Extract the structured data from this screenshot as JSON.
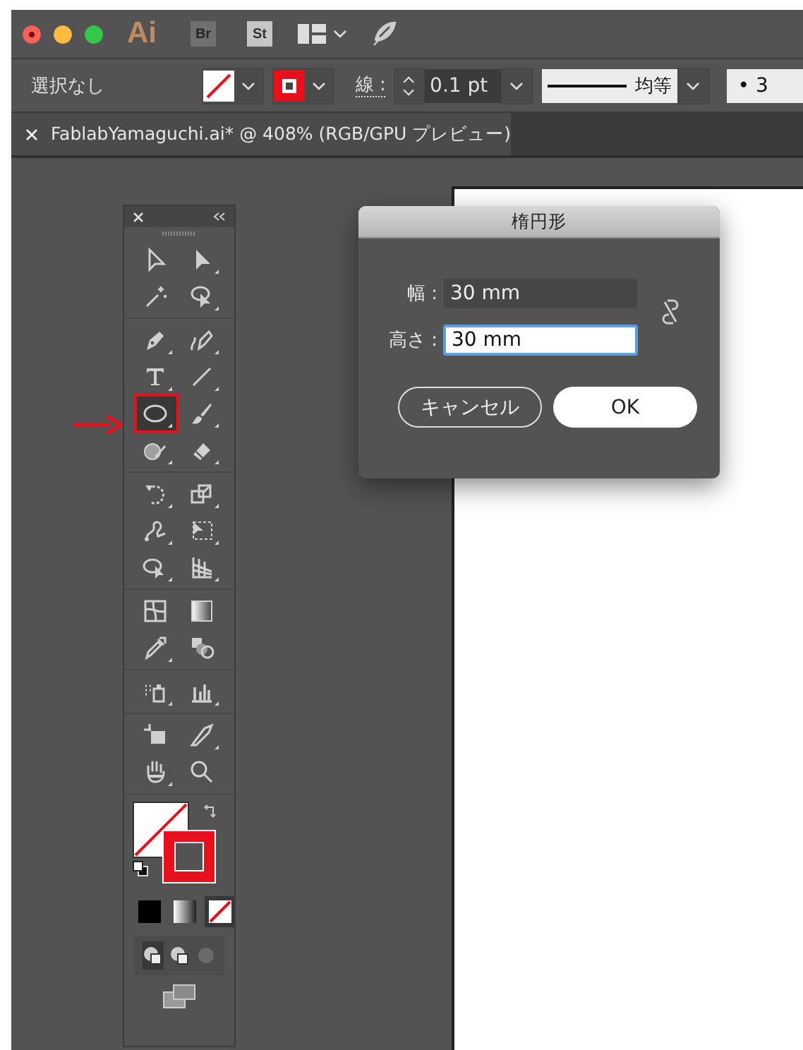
{
  "app_bar": {
    "logo": "Ai",
    "bridge": "Br",
    "stock": "St"
  },
  "control_bar": {
    "selection": "選択なし",
    "stroke_label": "線 :",
    "stroke_weight": "0.1 pt",
    "profile": "均等",
    "opacity_cut": "• 3"
  },
  "document_tab": {
    "title": "FablabYamaguchi.ai* @ 408% (RGB/GPU プレビュー)",
    "selected": true
  },
  "tool_groups": [
    {
      "tools": [
        {
          "selected": false,
          "annotated": false
        },
        {
          "selected": false,
          "annotated": false
        },
        {
          "selected": false,
          "annotated": false
        },
        {
          "selected": false,
          "annotated": false
        }
      ]
    },
    {
      "tools": [
        {
          "selected": false,
          "annotated": false
        },
        {
          "selected": false,
          "annotated": false
        },
        {
          "selected": false,
          "annotated": false
        },
        {
          "selected": false,
          "annotated": false
        },
        {
          "selected": true,
          "annotated": true
        },
        {
          "selected": false,
          "annotated": false
        },
        {
          "selected": false,
          "annotated": false
        },
        {
          "selected": false,
          "annotated": false
        }
      ]
    },
    {
      "tools": [
        {
          "selected": false,
          "annotated": false
        },
        {
          "selected": false,
          "annotated": false
        },
        {
          "selected": false,
          "annotated": false
        },
        {
          "selected": false,
          "annotated": false
        },
        {
          "selected": false,
          "annotated": false
        },
        {
          "selected": false,
          "annotated": false
        }
      ]
    },
    {
      "tools": [
        {
          "selected": false,
          "annotated": false
        },
        {
          "selected": false,
          "annotated": false
        },
        {
          "selected": false,
          "annotated": false
        },
        {
          "selected": false,
          "annotated": false
        }
      ]
    },
    {
      "tools": [
        {
          "selected": false,
          "annotated": false
        },
        {
          "selected": false,
          "annotated": false
        }
      ]
    },
    {
      "tools": [
        {
          "selected": false,
          "annotated": false
        },
        {
          "selected": false,
          "annotated": false
        },
        {
          "selected": false,
          "annotated": false
        },
        {
          "selected": false,
          "annotated": false
        }
      ]
    }
  ],
  "color_modes": [
    {
      "selected": false
    },
    {
      "selected": false
    },
    {
      "selected": true
    }
  ],
  "draw_modes": [
    {
      "selected": true,
      "disabled": false
    },
    {
      "selected": false,
      "disabled": false
    },
    {
      "selected": false,
      "disabled": true
    }
  ],
  "dialog": {
    "title": "楕円形",
    "fields": [
      {
        "label": "幅 :",
        "value": "30 mm",
        "focused": false
      },
      {
        "label": "高さ :",
        "value": "30 mm",
        "focused": true
      }
    ],
    "buttons": [
      {
        "label": "キャンセル",
        "default": false
      },
      {
        "label": "OK",
        "default": true
      }
    ]
  }
}
